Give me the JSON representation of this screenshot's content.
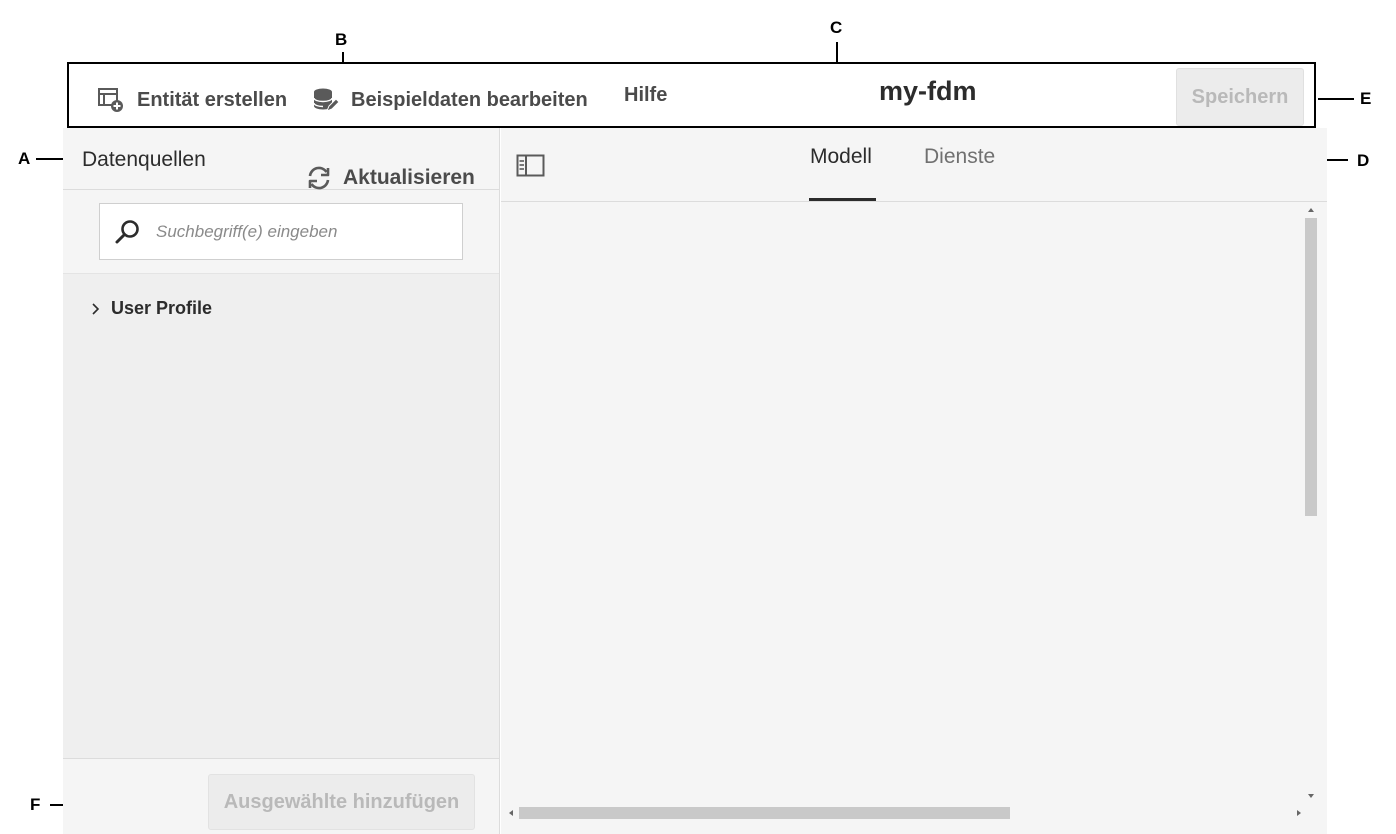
{
  "callouts": {
    "a": "A",
    "b": "B",
    "c": "C",
    "d": "D",
    "e": "E",
    "f": "F"
  },
  "toolbar": {
    "create_entity_label": "Entität erstellen",
    "edit_sample_data_label": "Beispieldaten bearbeiten",
    "help_label": "Hilfe",
    "title": "my-fdm",
    "save_label": "Speichern",
    "icons": [
      "create-entity-icon",
      "edit-sample-data-icon"
    ]
  },
  "left_panel": {
    "title": "Datenquellen",
    "refresh_label": "Aktualisieren",
    "search": {
      "placeholder": "Suchbegriff(e) eingeben"
    },
    "tree": [
      {
        "label": "User Profile",
        "expanded": false
      }
    ],
    "add_selected_label": "Ausgewählte hinzufügen"
  },
  "right_panel": {
    "tabs": [
      {
        "label": "Modell",
        "active": true
      },
      {
        "label": "Dienste",
        "active": false
      }
    ]
  },
  "colors": {
    "panel_bg": "#f5f5f5",
    "text_dark": "#2c2c2c",
    "disabled_text": "#b9b9b9",
    "scroll_thumb": "#c9c9c9"
  }
}
